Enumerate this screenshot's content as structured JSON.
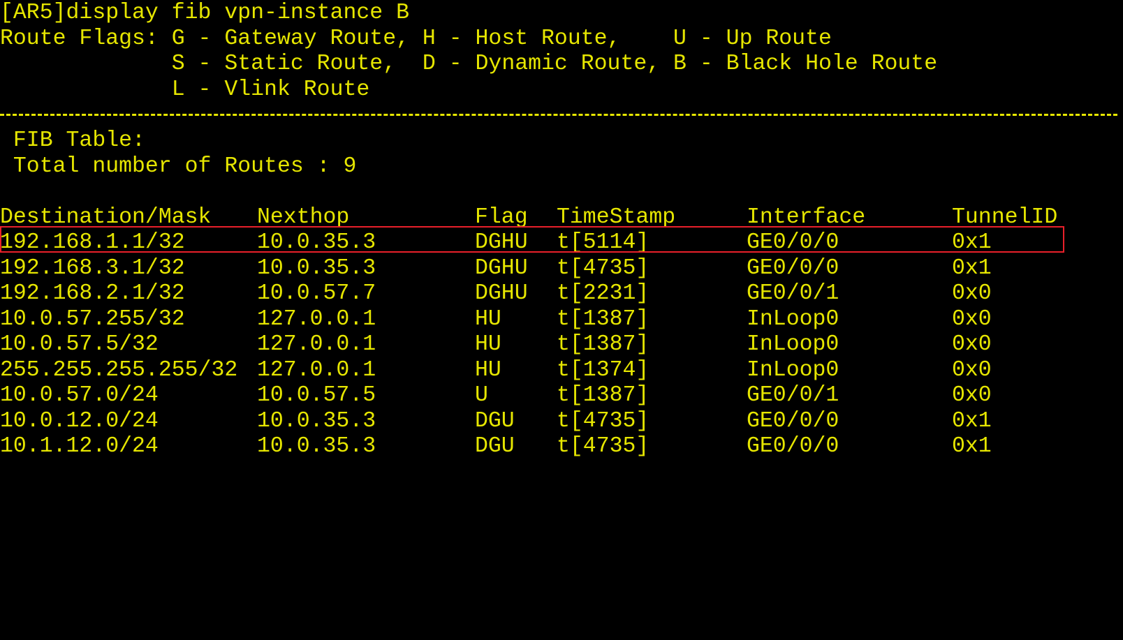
{
  "command": "[AR5]display fib vpn-instance B",
  "flags": {
    "line1": "Route Flags: G - Gateway Route, H - Host Route,    U - Up Route",
    "line2": "             S - Static Route,  D - Dynamic Route, B - Black Hole Route",
    "line3": "             L - Vlink Route"
  },
  "fib": {
    "title": " FIB Table:",
    "total": " Total number of Routes : 9"
  },
  "table": {
    "headers": {
      "destination": "Destination/Mask",
      "nexthop": "Nexthop",
      "flag": "Flag",
      "timestamp": "TimeStamp",
      "interface": "Interface",
      "tunnelid": "TunnelID"
    },
    "rows": [
      {
        "destination": "192.168.1.1/32",
        "nexthop": "10.0.35.3",
        "flag": "DGHU",
        "timestamp": "t[5114]",
        "interface": "GE0/0/0",
        "tunnelid": "0x1"
      },
      {
        "destination": "192.168.3.1/32",
        "nexthop": "10.0.35.3",
        "flag": "DGHU",
        "timestamp": "t[4735]",
        "interface": "GE0/0/0",
        "tunnelid": "0x1"
      },
      {
        "destination": "192.168.2.1/32",
        "nexthop": "10.0.57.7",
        "flag": "DGHU",
        "timestamp": "t[2231]",
        "interface": "GE0/0/1",
        "tunnelid": "0x0"
      },
      {
        "destination": "10.0.57.255/32",
        "nexthop": "127.0.0.1",
        "flag": "HU",
        "timestamp": "t[1387]",
        "interface": "InLoop0",
        "tunnelid": "0x0"
      },
      {
        "destination": "10.0.57.5/32",
        "nexthop": "127.0.0.1",
        "flag": "HU",
        "timestamp": "t[1387]",
        "interface": "InLoop0",
        "tunnelid": "0x0"
      },
      {
        "destination": "255.255.255.255/32",
        "nexthop": "127.0.0.1",
        "flag": "HU",
        "timestamp": "t[1374]",
        "interface": "InLoop0",
        "tunnelid": "0x0"
      },
      {
        "destination": "10.0.57.0/24",
        "nexthop": "10.0.57.5",
        "flag": "U",
        "timestamp": "t[1387]",
        "interface": "GE0/0/1",
        "tunnelid": "0x0"
      },
      {
        "destination": "10.0.12.0/24",
        "nexthop": "10.0.35.3",
        "flag": "DGU",
        "timestamp": "t[4735]",
        "interface": "GE0/0/0",
        "tunnelid": "0x1"
      },
      {
        "destination": "10.1.12.0/24",
        "nexthop": "10.0.35.3",
        "flag": "DGU",
        "timestamp": "t[4735]",
        "interface": "GE0/0/0",
        "tunnelid": "0x1"
      }
    ]
  },
  "colors": {
    "background": "#000000",
    "text": "#e6e600",
    "highlight": "#e8202a"
  }
}
